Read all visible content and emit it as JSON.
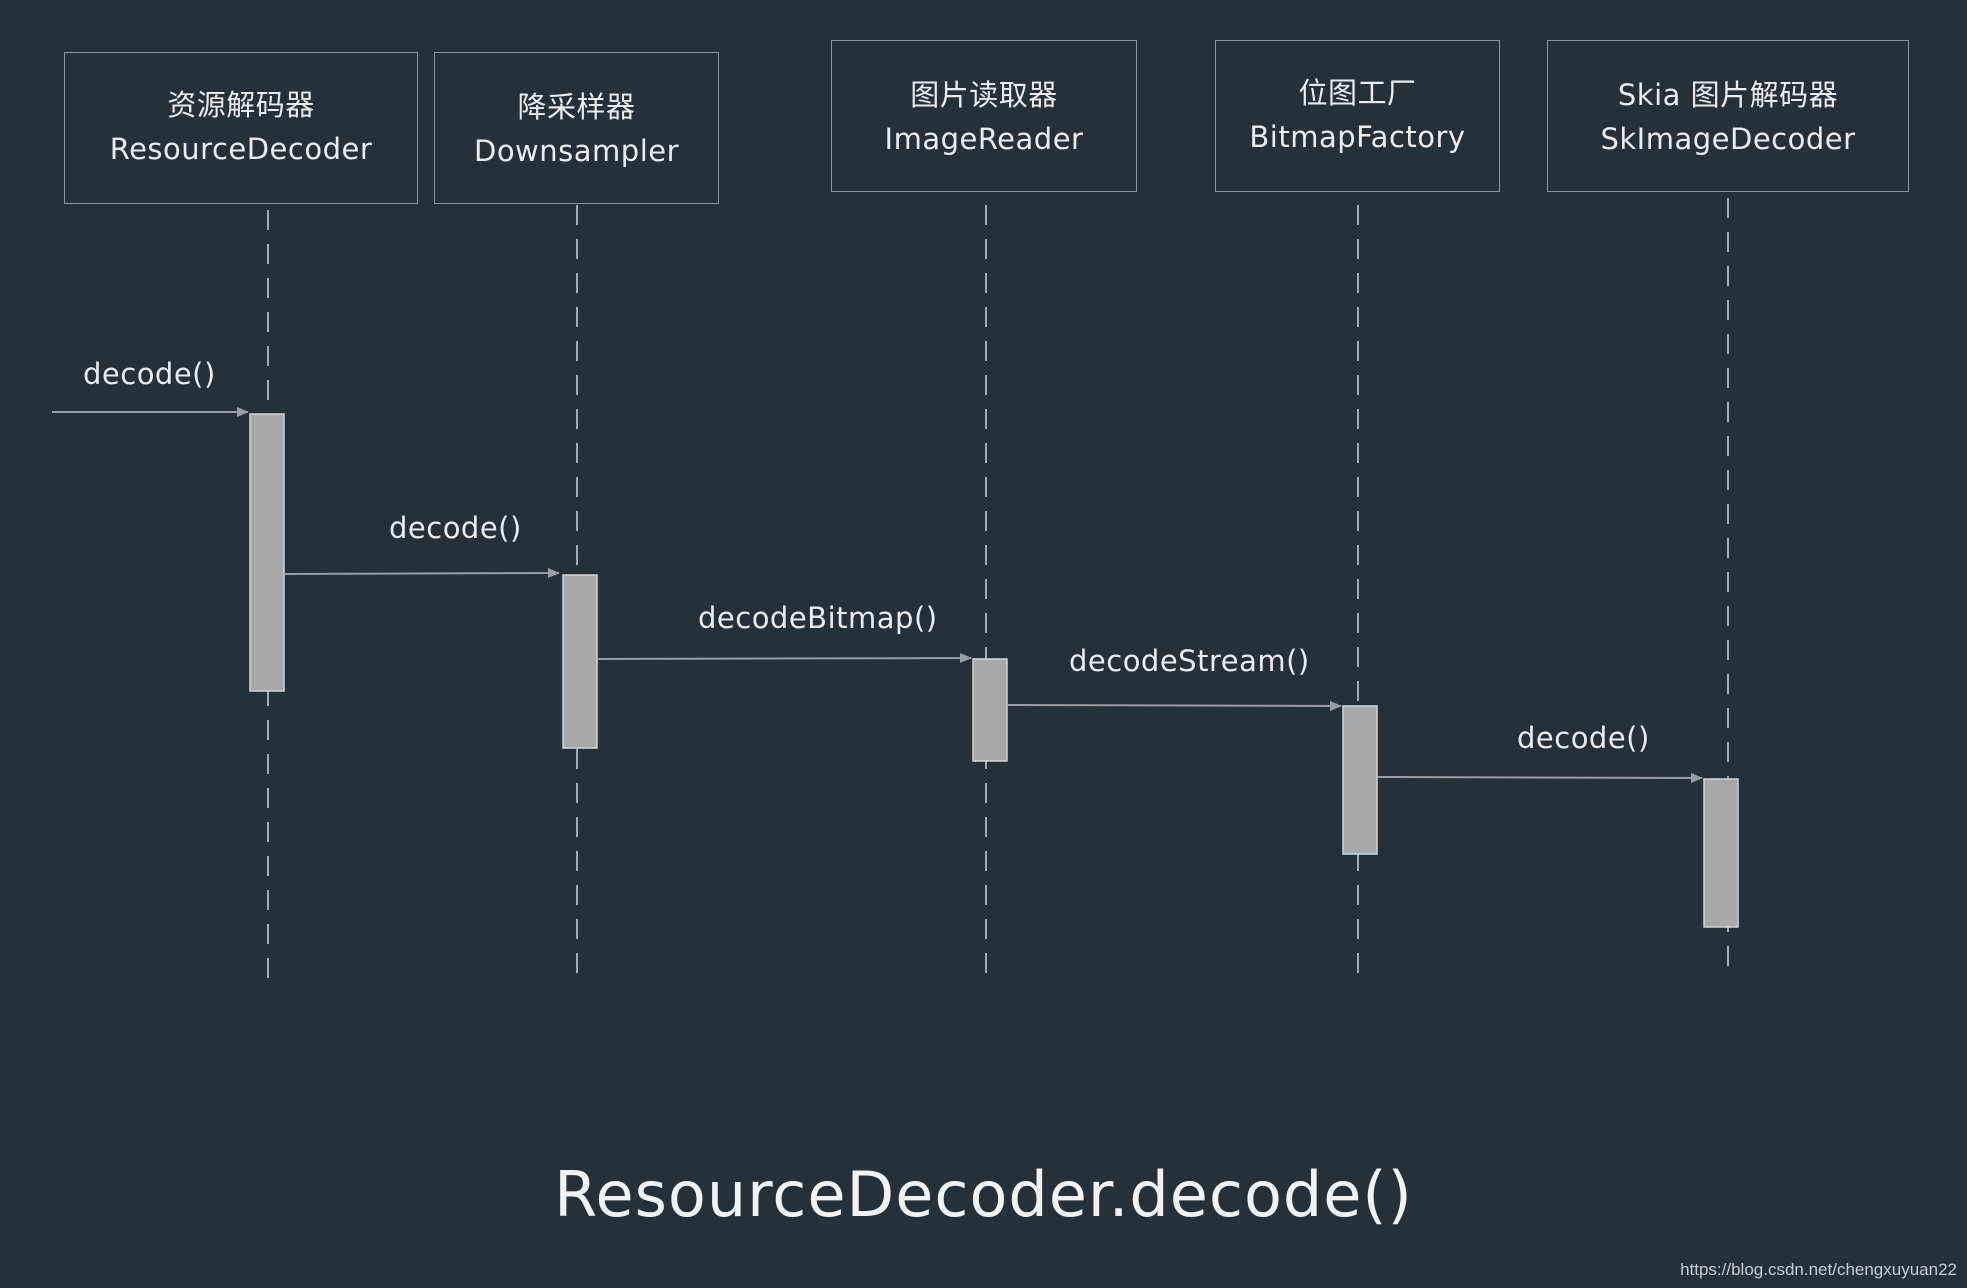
{
  "participants": [
    {
      "label_cn": "资源解码器",
      "label_en": "ResourceDecoder"
    },
    {
      "label_cn": "降采样器",
      "label_en": "Downsampler"
    },
    {
      "label_cn": "图片读取器",
      "label_en": "ImageReader"
    },
    {
      "label_cn": "位图工厂",
      "label_en": "BitmapFactory"
    },
    {
      "label_cn": "Skia 图片解码器",
      "label_en": "SkImageDecoder"
    }
  ],
  "messages": [
    {
      "label": "decode()",
      "from": null,
      "to": 0
    },
    {
      "label": "decode()",
      "from": 0,
      "to": 1
    },
    {
      "label": "decodeBitmap()",
      "from": 1,
      "to": 2
    },
    {
      "label": "decodeStream()",
      "from": 2,
      "to": 3
    },
    {
      "label": "decode()",
      "from": 3,
      "to": 4
    }
  ],
  "caption": "ResourceDecoder.decode()",
  "watermark": "https://blog.csdn.net/chengxuyuan22",
  "colors": {
    "background": "#263038",
    "box_border": "#8f969c",
    "lifeline": "#a5abb0",
    "activation_fill": "#a8a8a8",
    "activation_stroke": "#d4d4d4",
    "arrow": "#9a9ea2",
    "text": "#ececec"
  }
}
